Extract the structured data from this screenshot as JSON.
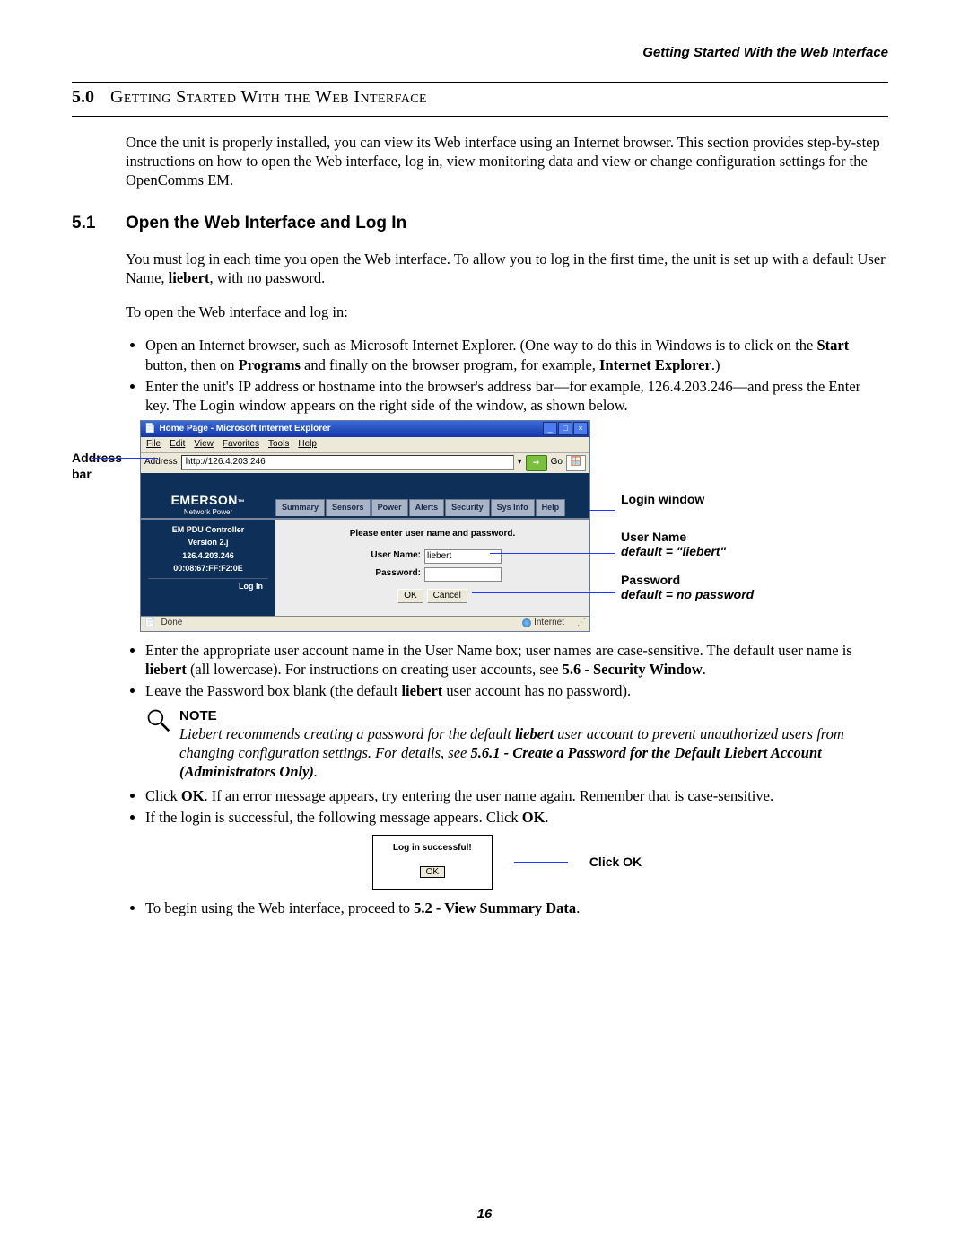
{
  "runningHead": "Getting Started With the Web Interface",
  "section": {
    "num": "5.0",
    "title": "Getting Started With the Web Interface",
    "intro": "Once the unit is properly installed, you can view its Web interface using an Internet browser. This section provides step-by-step instructions on how to open the Web interface, log in, view monitoring data and view or change configuration settings for the OpenComms EM."
  },
  "sub": {
    "num": "5.1",
    "title": "Open the Web Interface and Log In",
    "p1": "You must log in each time you open the Web interface. To allow you to log in the first time, the unit is set up with a default User Name, ",
    "p1b": "liebert",
    "p1c": ", with no password.",
    "p2": "To open the Web interface and log in:",
    "bul1a": "Open an Internet browser, such as Microsoft Internet Explorer. (One way to do this in Windows is to click on the ",
    "bul1b": "Start",
    "bul1c": " button, then on ",
    "bul1d": "Programs",
    "bul1e": " and finally on the browser program, for example, ",
    "bul1f": "Internet Explorer",
    "bul1g": ".)",
    "bul2": "Enter the unit's IP address or hostname into the browser's address bar—for example, 126.4.203.246—and press the Enter key. The Login window appears on the right side of the window, as shown below."
  },
  "addrLabel": "Address bar",
  "callouts": {
    "loginWin": "Login window",
    "userName": "User Name",
    "userNameDefault": "default = \"liebert\"",
    "password": "Password",
    "passwordDefault": "default = no password"
  },
  "browser": {
    "title": "Home Page - Microsoft Internet Explorer",
    "menus": [
      "File",
      "Edit",
      "View",
      "Favorites",
      "Tools",
      "Help"
    ],
    "addrLabel": "Address",
    "url": "http://126.4.203.246",
    "go": "Go",
    "brand": "EMERSON",
    "brandSub": "Network Power",
    "tabs": [
      "Summary",
      "Sensors",
      "Power",
      "Alerts",
      "Security",
      "Sys Info",
      "Help"
    ],
    "side": {
      "l1": "EM PDU Controller",
      "l2": "Version 2.j",
      "l3": "126.4.203.246",
      "l4": "00:08:67:FF:F2:0E",
      "login": "Log In"
    },
    "login": {
      "prompt": "Please enter user name and password.",
      "userLabel": "User Name:",
      "userValue": "liebert",
      "passLabel": "Password:",
      "ok": "OK",
      "cancel": "Cancel"
    },
    "status": {
      "done": "Done",
      "zone": "Internet"
    }
  },
  "after": {
    "bul3a": "Enter the appropriate user account name in the User Name box; user names are case-sensitive. The default user name is ",
    "bul3b": "liebert",
    "bul3c": " (all lowercase). For instructions on creating user accounts, see ",
    "bul3d": "5.6 - Security Window",
    "bul3e": ".",
    "bul4a": "Leave the Password box blank (the default ",
    "bul4b": "liebert",
    "bul4c": " user account has no password).",
    "noteHead": "NOTE",
    "note1": "Liebert recommends creating a password for the default ",
    "note1b": "liebert",
    "note1c": " user account to prevent unauthorized users from changing configuration settings. For details, see ",
    "note1d": "5.6.1 - Create a Password for the Default Liebert Account (Administrators Only)",
    "note1e": ".",
    "bul5a": "Click ",
    "bul5b": "OK",
    "bul5c": ". If an error message appears, try entering the user name again. Remember that is case-sensitive.",
    "bul6a": "If the login is successful, the following message appears. Click ",
    "bul6b": "OK",
    "bul6c": ".",
    "dlgMsg": "Log in successful!",
    "dlgOk": "OK",
    "clickOk": "Click OK",
    "bul7a": "To begin using the Web interface, proceed to ",
    "bul7b": "5.2 - View Summary Data",
    "bul7c": "."
  },
  "pageNum": "16"
}
